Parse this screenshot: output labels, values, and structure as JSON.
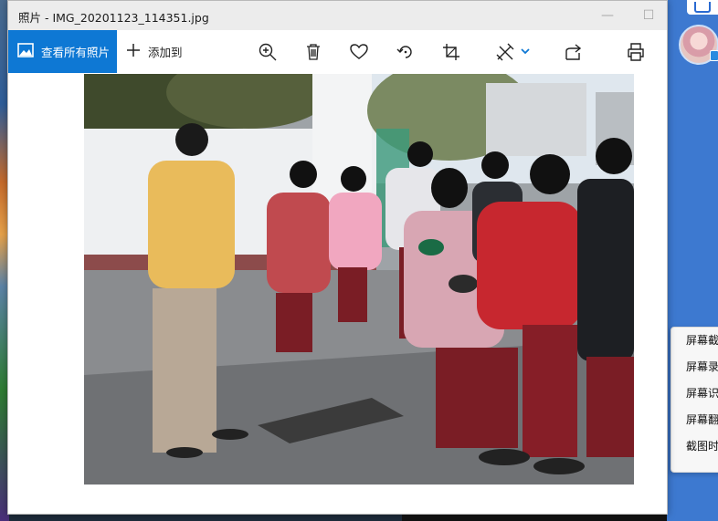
{
  "window": {
    "title": "照片 - IMG_20201123_114351.jpg",
    "minimize_glyph": "—",
    "maximize_glyph": "☐"
  },
  "toolbar": {
    "view_all_label": "查看所有照片",
    "add_to_label": "添加到",
    "icons": [
      "zoom-in-icon",
      "delete-icon",
      "favorite-heart-icon",
      "rotate-icon",
      "crop-icon",
      "edit-create-icon",
      "share-icon",
      "print-icon"
    ]
  },
  "photo": {
    "description_hidden": false
  },
  "context_menu": {
    "items": [
      "屏幕截",
      "屏幕录",
      "屏幕识",
      "屏幕翻",
      "截图时"
    ]
  },
  "colors": {
    "accent": "#0e78d4",
    "titlebar": "#ececec",
    "desktop_right": "#3d79d0"
  }
}
